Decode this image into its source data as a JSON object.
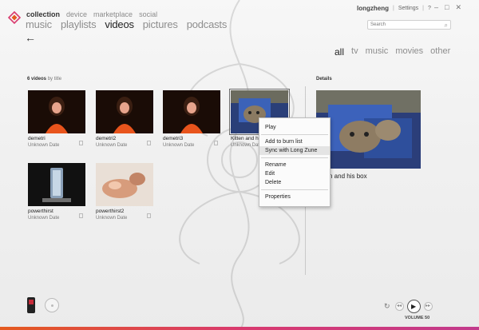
{
  "nav": {
    "top": [
      "collection",
      "device",
      "marketplace",
      "social"
    ],
    "main": [
      "music",
      "playlists",
      "videos",
      "pictures",
      "podcasts"
    ]
  },
  "user": {
    "name": "longzheng",
    "settings": "Settings",
    "help": "?"
  },
  "window_buttons": [
    "–",
    "□",
    "✕"
  ],
  "search": {
    "placeholder": "Search"
  },
  "filters": [
    "all",
    "tv",
    "music",
    "movies",
    "other"
  ],
  "list": {
    "count": "6 videos",
    "sort": "by title"
  },
  "details": {
    "label": "Details",
    "title": "n and his box"
  },
  "videos": [
    {
      "title": "demetri",
      "date": "Unknown Date"
    },
    {
      "title": "demetri2",
      "date": "Unknown Date"
    },
    {
      "title": "demetri3",
      "date": "Unknown Date"
    },
    {
      "title": "Kitten and h",
      "date": "Unknown Date"
    },
    {
      "title": "powerthirst",
      "date": "Unknown Date"
    },
    {
      "title": "powerthirst2",
      "date": "Unknown Date"
    }
  ],
  "context_menu": {
    "play": "Play",
    "burn": "Add to burn list",
    "sync": "Sync with Long Zune",
    "rename": "Rename",
    "edit": "Edit",
    "delete": "Delete",
    "properties": "Properties"
  },
  "player": {
    "volume": "VOLUME 50"
  },
  "icons": {
    "logo": "zune-logo-icon",
    "back": "back-arrow-icon",
    "search": "search-icon",
    "repeat": "repeat-icon",
    "prev": "previous-icon",
    "play": "play-icon",
    "next": "next-icon",
    "device": "zune-device-icon",
    "disc": "disc-icon"
  },
  "colors": {
    "accent": "#d93a6e",
    "orange": "#e45a1f"
  }
}
